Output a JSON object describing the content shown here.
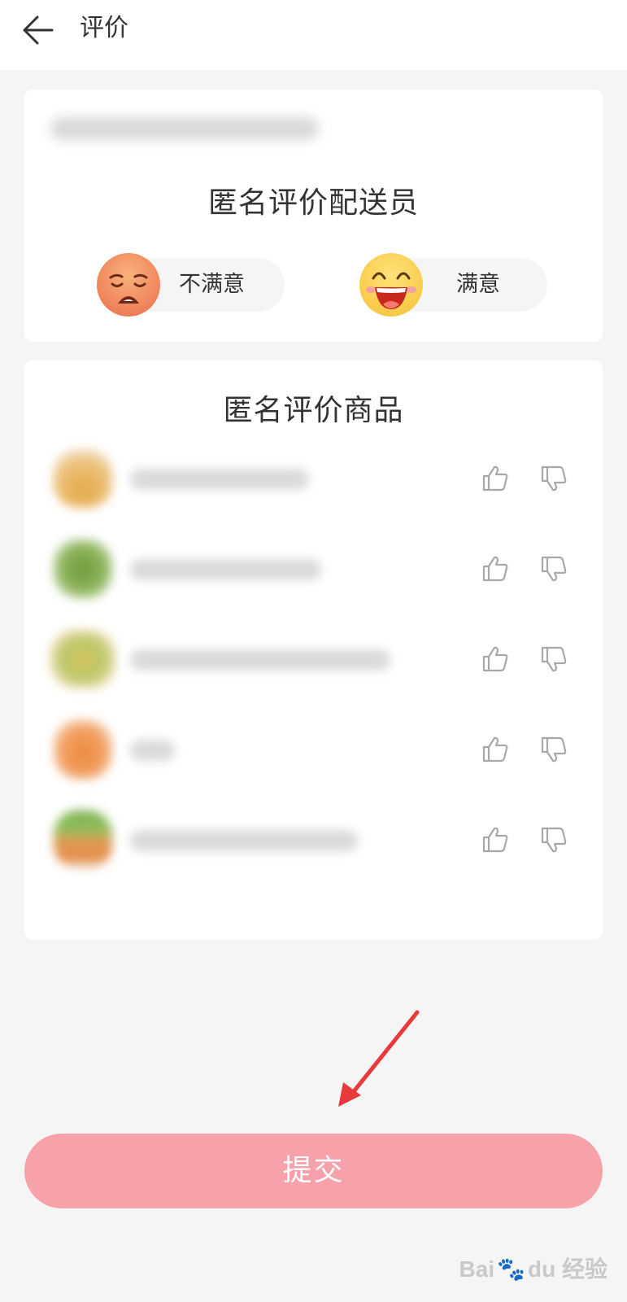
{
  "header": {
    "title": "评价"
  },
  "courier_section": {
    "title": "匿名评价配送员",
    "unsatisfied_label": "不满意",
    "satisfied_label": "满意"
  },
  "products_section": {
    "title": "匿名评价商品"
  },
  "submit_label": "提交",
  "watermark": {
    "text": "Bai",
    "text2": "du",
    "text3": "经验"
  },
  "colors": {
    "submit": "#f7a1aa",
    "annotation_arrow": "#e83a3a"
  }
}
